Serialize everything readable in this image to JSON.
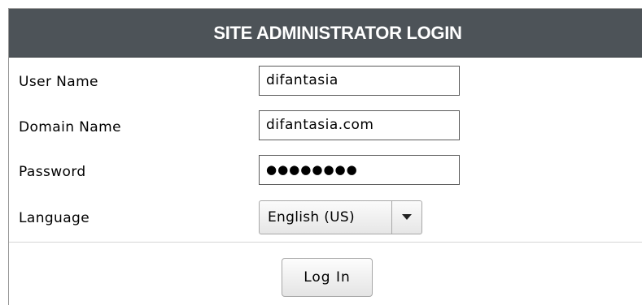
{
  "header": {
    "title": "SITE ADMINISTRATOR LOGIN"
  },
  "form": {
    "username": {
      "label": "User Name",
      "value": "difantasia"
    },
    "domain": {
      "label": "Domain Name",
      "value": "difantasia.com"
    },
    "password": {
      "label": "Password",
      "masked_value": "●●●●●●●●"
    },
    "language": {
      "label": "Language",
      "selected": "English (US)",
      "arrow_icon": "triangle-down-icon"
    },
    "login_button_label": "Log In"
  },
  "colors": {
    "header_bg": "#4d5358",
    "header_text": "#ffffff"
  }
}
